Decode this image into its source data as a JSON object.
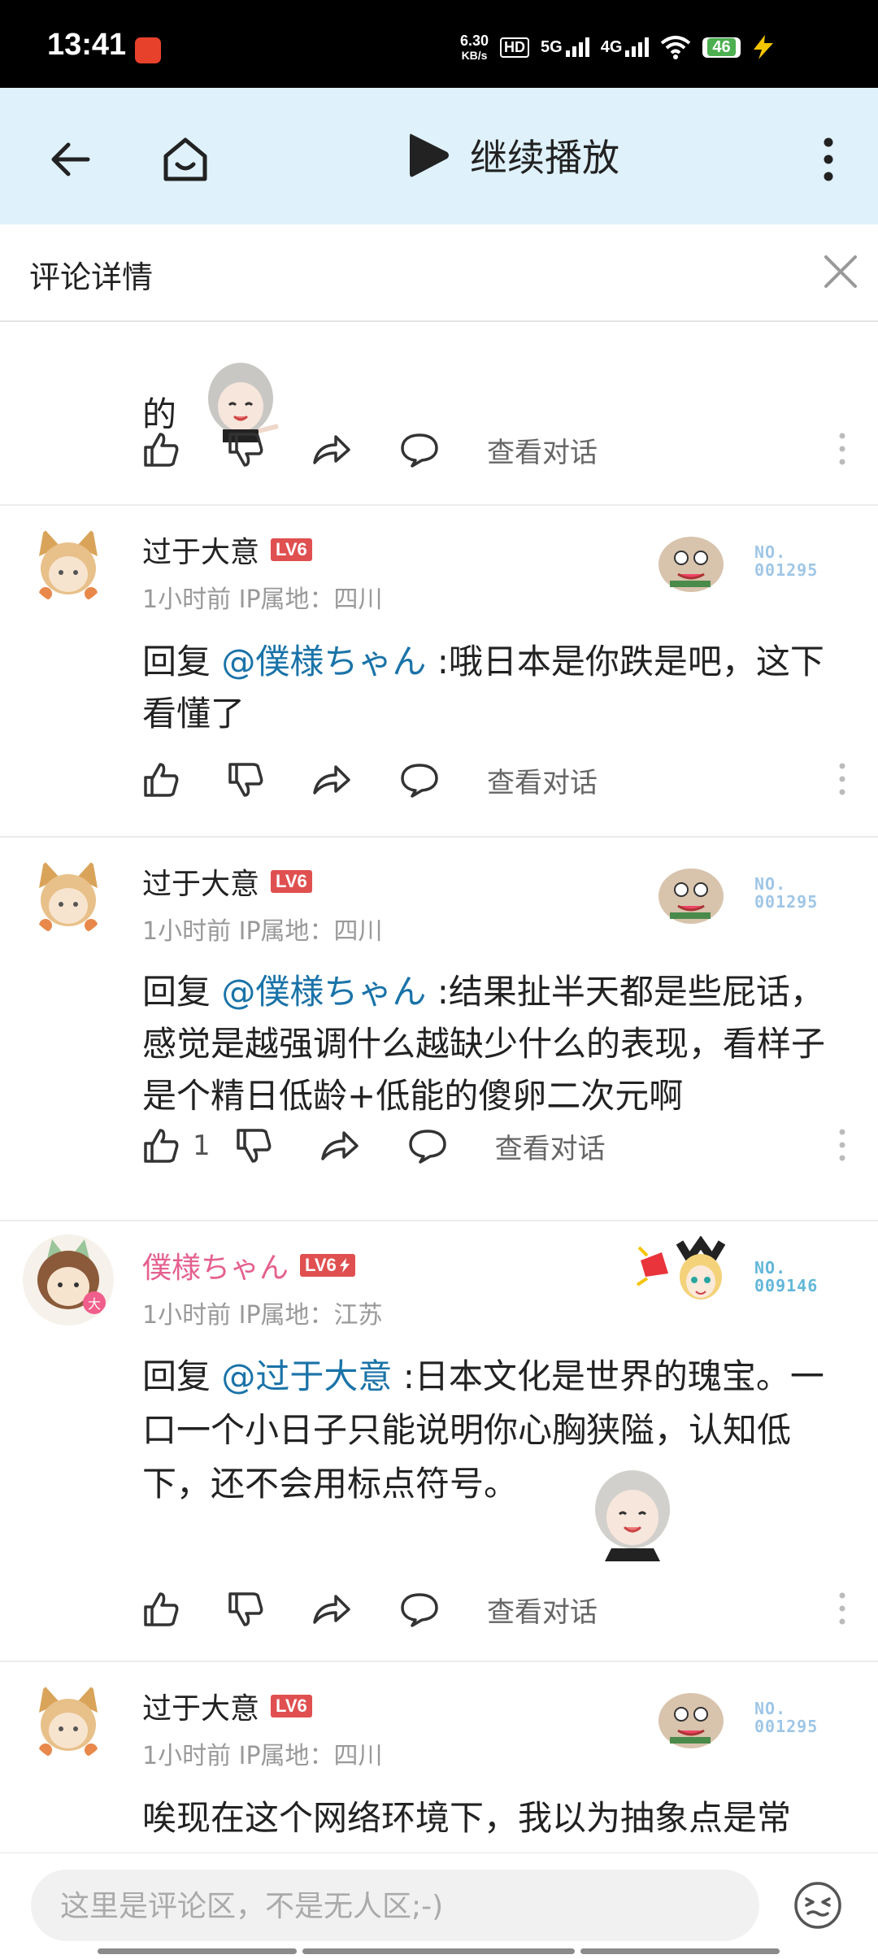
{
  "status_bar": {
    "time": "13:41",
    "speed_value": "6.30",
    "speed_unit": "KB/s",
    "hd": "HD",
    "signal1": "5G",
    "signal2": "4G",
    "battery": "46"
  },
  "top_bar": {
    "title": "继续播放"
  },
  "sheet": {
    "title": "评论详情"
  },
  "comments": [
    {
      "text": "的",
      "see_conversation": "查看对话"
    },
    {
      "username": "过于大意",
      "level": "LV6",
      "meta": "1小时前 IP属地：四川",
      "reply_prefix": "回复 ",
      "mention": "@僕様ちゃん",
      "text": " :哦日本是你跌是吧，这下看懂了",
      "see_conversation": "查看对话",
      "badge_no": "NO.",
      "badge_num": "001295"
    },
    {
      "username": "过于大意",
      "level": "LV6",
      "meta": "1小时前 IP属地：四川",
      "reply_prefix": "回复 ",
      "mention": "@僕様ちゃん",
      "text": " :结果扯半天都是些屁话，感觉是越强调什么越缺少什么的表现，看样子是个精日低龄+低能的傻卵二次元啊",
      "likes": "1",
      "see_conversation": "查看对话",
      "badge_no": "NO.",
      "badge_num": "001295"
    },
    {
      "username": "僕様ちゃん",
      "level": "LV6",
      "meta": "1小时前 IP属地：江苏",
      "reply_prefix": "回复 ",
      "mention": "@过于大意",
      "text": " :日本文化是世界的瑰宝。一口一个小日子只能说明你心胸狭隘，认知低下，还不会用标点符号。",
      "see_conversation": "查看对话",
      "badge_no": "NO.",
      "badge_num": "009146"
    },
    {
      "username": "过于大意",
      "level": "LV6",
      "meta": "1小时前 IP属地：四川",
      "text": "唉现在这个网络环境下，我以为抽象点是常",
      "badge_no": "NO.",
      "badge_num": "001295"
    }
  ],
  "input": {
    "placeholder": "这里是评论区，不是无人区;-)"
  },
  "colors": {
    "topbar_bg": "#dff1fb",
    "mention": "#1a73a8",
    "vip_name": "#e5608f",
    "level_badge": "#e05050"
  }
}
